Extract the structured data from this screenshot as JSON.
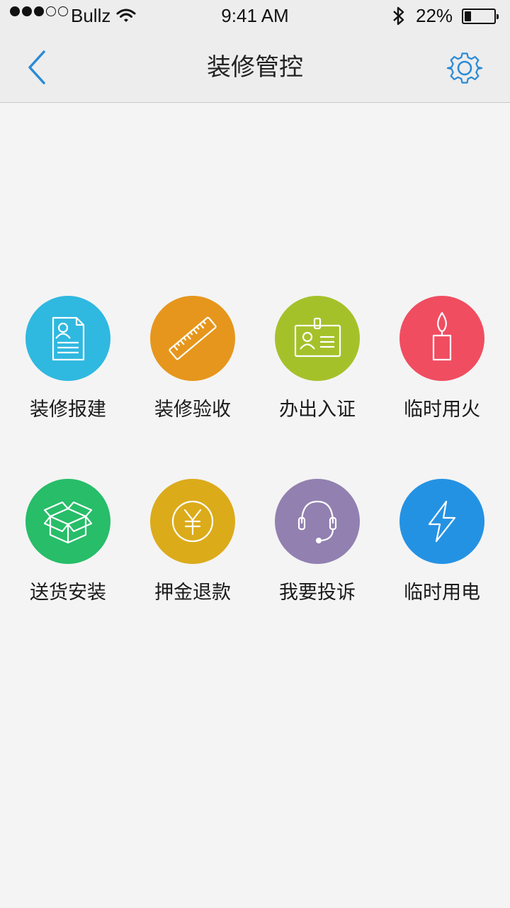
{
  "status_bar": {
    "carrier": "Bullz",
    "time": "9:41 AM",
    "battery_percent": "22%",
    "battery_level": 0.22,
    "signal_bars_filled": 3,
    "signal_bars_total": 5
  },
  "nav": {
    "title": "装修管控",
    "back_icon": "chevron-left-icon",
    "settings_icon": "gear-icon",
    "accent_color": "#2a8bd6"
  },
  "tiles": [
    {
      "label": "装修报建",
      "icon": "document-user-icon",
      "color": "#2fb8e0"
    },
    {
      "label": "装修验收",
      "icon": "ruler-icon",
      "color": "#e6961c"
    },
    {
      "label": "办出入证",
      "icon": "id-card-icon",
      "color": "#a5c12a"
    },
    {
      "label": "临时用火",
      "icon": "candle-icon",
      "color": "#f04d61"
    },
    {
      "label": "送货安装",
      "icon": "box-icon",
      "color": "#27bd69"
    },
    {
      "label": "押金退款",
      "icon": "yen-coin-icon",
      "color": "#dbab1a"
    },
    {
      "label": "我要投诉",
      "icon": "headset-icon",
      "color": "#9280b0"
    },
    {
      "label": "临时用电",
      "icon": "lightning-icon",
      "color": "#2492e3"
    }
  ]
}
